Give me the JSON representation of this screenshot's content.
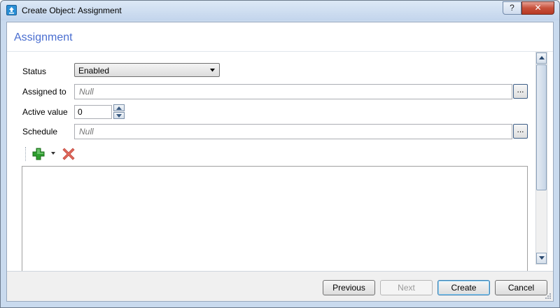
{
  "window": {
    "title": "Create Object: Assignment",
    "help_label": "?",
    "close_label": "✕"
  },
  "page": {
    "title": "Assignment"
  },
  "form": {
    "status": {
      "label": "Status",
      "value": "Enabled"
    },
    "assigned_to": {
      "label": "Assigned to",
      "placeholder": "Null",
      "button_label": "..."
    },
    "active_value": {
      "label": "Active value",
      "value": "0"
    },
    "schedule": {
      "label": "Schedule",
      "placeholder": "Null",
      "button_label": "..."
    }
  },
  "buttons": {
    "previous": "Previous",
    "next": "Next",
    "create": "Create",
    "cancel": "Cancel"
  },
  "colors": {
    "accent": "#4a6ed0",
    "add": "#2e9e2e",
    "remove": "#e06a5e"
  }
}
